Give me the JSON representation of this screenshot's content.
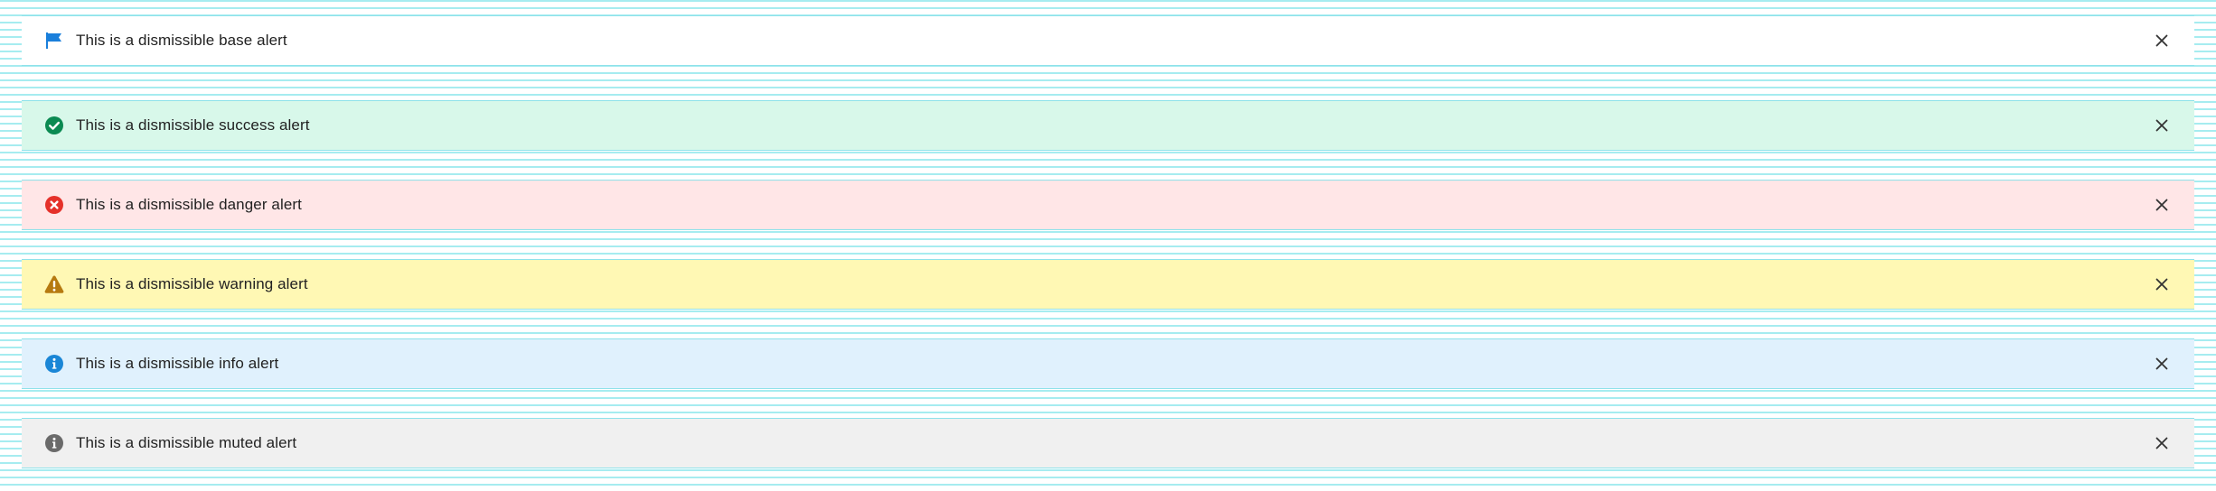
{
  "alerts": [
    {
      "variant": "base",
      "label": "This is a dismissible base alert",
      "icon": "flag-icon",
      "background": "#ffffff",
      "icon_color": "#1a7fdb"
    },
    {
      "variant": "success",
      "label": "This is a dismissible success alert",
      "icon": "check-circle-icon",
      "background": "#d8f8ea",
      "icon_color": "#0b8a52"
    },
    {
      "variant": "danger",
      "label": "This is a dismissible danger alert",
      "icon": "x-circle-icon",
      "background": "#ffe6e7",
      "icon_color": "#e5312a"
    },
    {
      "variant": "warning",
      "label": "This is a dismissible warning alert",
      "icon": "warning-triangle-icon",
      "background": "#fff8b4",
      "icon_color": "#b67a10"
    },
    {
      "variant": "info",
      "label": "This is a dismissible info alert",
      "icon": "info-circle-icon",
      "background": "#e0f1fd",
      "icon_color": "#1a86d6"
    },
    {
      "variant": "muted",
      "label": "This is a dismissible muted alert",
      "icon": "info-circle-icon",
      "background": "#f0f0f0",
      "icon_color": "#6a6a6a"
    }
  ],
  "close_icon": "close-icon",
  "close_color": "#333333"
}
